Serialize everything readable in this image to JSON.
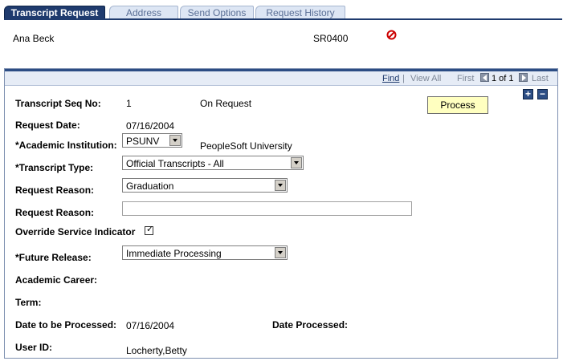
{
  "tabs": [
    {
      "label": "Transcript Request",
      "active": true
    },
    {
      "label": "Address",
      "active": false
    },
    {
      "label": "Send Options",
      "active": false
    },
    {
      "label": "Request History",
      "active": false
    }
  ],
  "student": {
    "name": "Ana Beck",
    "id": "SR0400"
  },
  "nav": {
    "find": "Find",
    "separator": "|",
    "view_all": "View All",
    "first": "First",
    "count": "1 of 1",
    "last": "Last"
  },
  "form": {
    "seq_label": "Transcript Seq No:",
    "seq_value": "1",
    "status_value": "On Request",
    "process_label": "Process",
    "request_date_label": "Request Date:",
    "request_date_value": "07/16/2004",
    "institution_label": "*Academic Institution:",
    "institution_value": "PSUNV",
    "institution_desc": "PeopleSoft University",
    "transcript_type_label": "*Transcript Type:",
    "transcript_type_value": "Official Transcripts - All",
    "reason_label": "Request Reason:",
    "reason_value": "Graduation",
    "reason_text_label": "Request Reason:",
    "reason_text_value": "",
    "override_label": "Override Service Indicator",
    "override_checked": true,
    "future_release_label": "*Future Release:",
    "future_release_value": "Immediate Processing",
    "career_label": "Academic Career:",
    "term_label": "Term:",
    "date_to_process_label": "Date to be Processed:",
    "date_to_process_value": "07/16/2004",
    "date_processed_label": "Date Processed:",
    "user_id_label": "User ID:",
    "user_id_value": "Locherty,Betty"
  },
  "colors": {
    "accent": "#1f3b6e",
    "process_button": "#ffffc0",
    "stop_icon": "#cc0000"
  }
}
